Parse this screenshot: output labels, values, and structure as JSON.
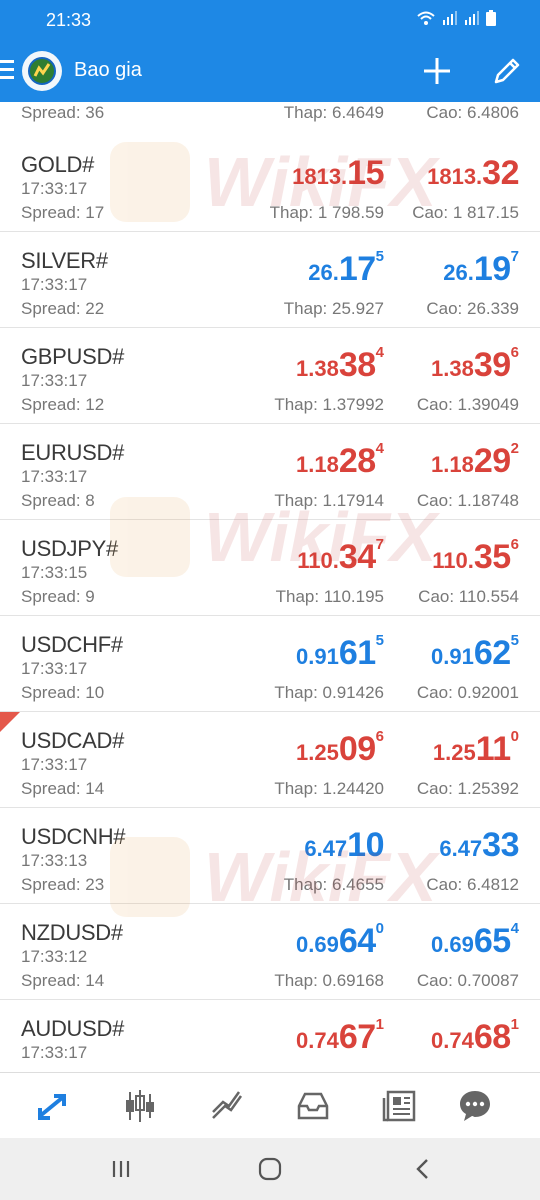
{
  "status_bar": {
    "time": "21:33"
  },
  "app_bar": {
    "title": "Bao gia"
  },
  "partial_row": {
    "spread": "Spread: 36",
    "low": "Thap: 6.4649",
    "high": "Cao: 6.4806"
  },
  "quotes": [
    {
      "symbol": "GOLD#",
      "time": "17:33:17",
      "spread": "Spread: 17",
      "color": "#d9433b",
      "bid": {
        "small": "1813.",
        "big": "15",
        "sup": ""
      },
      "ask": {
        "small": "1813.",
        "big": "32",
        "sup": ""
      },
      "low": "Thap: 1 798.59",
      "high": "Cao: 1 817.15"
    },
    {
      "symbol": "SILVER#",
      "time": "17:33:17",
      "spread": "Spread: 22",
      "color": "#1e7fe0",
      "bid": {
        "small": "26.",
        "big": "17",
        "sup": "5"
      },
      "ask": {
        "small": "26.",
        "big": "19",
        "sup": "7"
      },
      "low": "Thap: 25.927",
      "high": "Cao: 26.339"
    },
    {
      "symbol": "GBPUSD#",
      "time": "17:33:17",
      "spread": "Spread: 12",
      "color": "#d9433b",
      "bid": {
        "small": "1.38",
        "big": "38",
        "sup": "4"
      },
      "ask": {
        "small": "1.38",
        "big": "39",
        "sup": "6"
      },
      "low": "Thap: 1.37992",
      "high": "Cao: 1.39049"
    },
    {
      "symbol": "EURUSD#",
      "time": "17:33:17",
      "spread": "Spread: 8",
      "color": "#d9433b",
      "bid": {
        "small": "1.18",
        "big": "28",
        "sup": "4"
      },
      "ask": {
        "small": "1.18",
        "big": "29",
        "sup": "2"
      },
      "low": "Thap: 1.17914",
      "high": "Cao: 1.18748"
    },
    {
      "symbol": "USDJPY#",
      "time": "17:33:15",
      "spread": "Spread: 9",
      "color": "#d9433b",
      "bid": {
        "small": "110.",
        "big": "34",
        "sup": "7"
      },
      "ask": {
        "small": "110.",
        "big": "35",
        "sup": "6"
      },
      "low": "Thap: 110.195",
      "high": "Cao: 110.554"
    },
    {
      "symbol": "USDCHF#",
      "time": "17:33:17",
      "spread": "Spread: 10",
      "color": "#1e7fe0",
      "bid": {
        "small": "0.91",
        "big": "61",
        "sup": "5"
      },
      "ask": {
        "small": "0.91",
        "big": "62",
        "sup": "5"
      },
      "low": "Thap: 0.91426",
      "high": "Cao: 0.92001"
    },
    {
      "symbol": "USDCAD#",
      "time": "17:33:17",
      "spread": "Spread: 14",
      "color": "#d9433b",
      "bid": {
        "small": "1.25",
        "big": "09",
        "sup": "6"
      },
      "ask": {
        "small": "1.25",
        "big": "11",
        "sup": "0"
      },
      "low": "Thap: 1.24420",
      "high": "Cao: 1.25392",
      "flag": true
    },
    {
      "symbol": "USDCNH#",
      "time": "17:33:13",
      "spread": "Spread: 23",
      "color": "#1e7fe0",
      "bid": {
        "small": "6.47",
        "big": "10",
        "sup": ""
      },
      "ask": {
        "small": "6.47",
        "big": "33",
        "sup": ""
      },
      "low": "Thap: 6.4655",
      "high": "Cao: 6.4812"
    },
    {
      "symbol": "NZDUSD#",
      "time": "17:33:12",
      "spread": "Spread: 14",
      "color": "#1e7fe0",
      "bid": {
        "small": "0.69",
        "big": "64",
        "sup": "0"
      },
      "ask": {
        "small": "0.69",
        "big": "65",
        "sup": "4"
      },
      "low": "Thap: 0.69168",
      "high": "Cao: 0.70087"
    },
    {
      "symbol": "AUDUSD#",
      "time": "17:33:17",
      "spread": "",
      "color": "#d9433b",
      "bid": {
        "small": "0.74",
        "big": "67",
        "sup": "1"
      },
      "ask": {
        "small": "0.74",
        "big": "68",
        "sup": "1"
      },
      "low": "",
      "high": ""
    }
  ],
  "watermark": {
    "text": "WikiFX"
  },
  "tabs": [
    {
      "name": "quotes",
      "icon": "quotes-icon",
      "active": true
    },
    {
      "name": "charts",
      "icon": "candlestick-icon",
      "active": false
    },
    {
      "name": "trade",
      "icon": "trade-icon",
      "active": false
    },
    {
      "name": "history",
      "icon": "inbox-icon",
      "active": false
    },
    {
      "name": "news",
      "icon": "news-icon",
      "active": false
    },
    {
      "name": "chat",
      "icon": "chat-icon",
      "active": false
    }
  ],
  "colors": {
    "accent": "#1e88e5",
    "down": "#d9433b",
    "up": "#1e7fe0"
  }
}
